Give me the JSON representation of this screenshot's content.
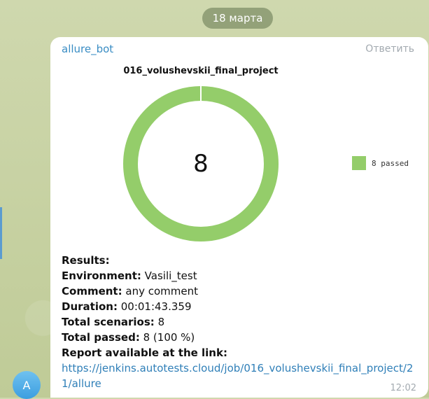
{
  "date_label": "18 марта",
  "message": {
    "sender": "allure_bot",
    "reply_label": "Ответить",
    "time": "12:02",
    "avatar_letter": "A"
  },
  "chart_data": {
    "type": "pie",
    "title": "016_volushevskii_final_project",
    "center_label": "8",
    "categories": [
      "passed"
    ],
    "values": [
      8
    ],
    "legend": [
      {
        "label": "8 passed",
        "color": "#94cd6a"
      }
    ],
    "legend_position": "right",
    "colors": [
      "#94cd6a"
    ]
  },
  "results": {
    "header": "Results:",
    "environment_label": "Environment:",
    "environment_value": "Vasili_test",
    "comment_label": "Comment:",
    "comment_value": "any comment",
    "duration_label": "Duration:",
    "duration_value": "00:01:43.359",
    "scenarios_label": "Total scenarios:",
    "scenarios_value": "8",
    "passed_label": "Total passed:",
    "passed_value": "8 (100 %)",
    "report_label": "Report available at the link:",
    "report_link": "https://jenkins.autotests.cloud/job/016_volushevskii_final_project/21/allure"
  }
}
